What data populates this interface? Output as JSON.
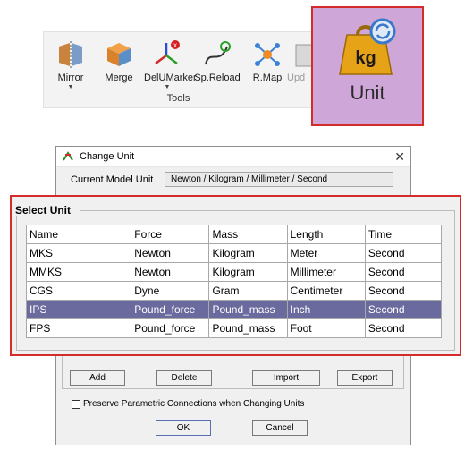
{
  "ribbon": {
    "buttons": [
      {
        "label": "Mirror",
        "icon": "mirror-icon",
        "dropdown": true
      },
      {
        "label": "Merge",
        "icon": "merge-cube-icon",
        "dropdown": false
      },
      {
        "label": "DelUMarker",
        "icon": "delete-marker-icon",
        "dropdown": true
      },
      {
        "label": "Sp.Reload",
        "icon": "spline-reload-icon",
        "dropdown": false
      },
      {
        "label": "R.Map",
        "icon": "network-map-icon",
        "dropdown": false
      },
      {
        "label": "Upd",
        "icon": "update-icon",
        "dropdown": false
      }
    ],
    "group_label": "Tools"
  },
  "unit_callout": {
    "icon": "kg-weight-unit-icon",
    "icon_text": "kg",
    "label": "Unit",
    "bg_color": "#cfa6d8",
    "border_color": "#d42b2b"
  },
  "dialog": {
    "title": "Change Unit",
    "close_glyph": "✕",
    "current_model_unit_label": "Current Model Unit",
    "current_model_unit_value": "Newton / Kilogram / Millimeter / Second",
    "select_unit_label": "Select Unit",
    "table": {
      "headers": [
        "Name",
        "Force",
        "Mass",
        "Length",
        "Time"
      ],
      "rows": [
        [
          "MKS",
          "Newton",
          "Kilogram",
          "Meter",
          "Second"
        ],
        [
          "MMKS",
          "Newton",
          "Kilogram",
          "Millimeter",
          "Second"
        ],
        [
          "CGS",
          "Dyne",
          "Gram",
          "Centimeter",
          "Second"
        ],
        [
          "IPS",
          "Pound_force",
          "Pound_mass",
          "Inch",
          "Second"
        ],
        [
          "FPS",
          "Pound_force",
          "Pound_mass",
          "Foot",
          "Second"
        ]
      ],
      "selected_row": 3,
      "selected_color": "#6a6a9e"
    },
    "buttons": {
      "add": "Add",
      "delete": "Delete",
      "import": "Import",
      "export": "Export",
      "ok": "OK",
      "cancel": "Cancel"
    },
    "preserve_label": "Preserve Parametric Connections when Changing Units",
    "preserve_checked": false
  }
}
